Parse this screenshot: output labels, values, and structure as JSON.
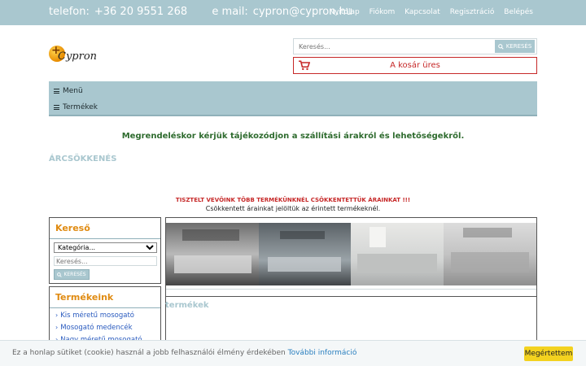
{
  "topbar": {
    "phone_label": "telefon:",
    "phone": "+36 20 9551 268",
    "email_label": "e mail:",
    "email": "cypron@cypron.hu",
    "nav": [
      "Nyitólap",
      "Fiókom",
      "Kapcsolat",
      "Regisztráció",
      "Belépés"
    ]
  },
  "logo": {
    "plus": "+",
    "name": "Cypron"
  },
  "search": {
    "placeholder": "Keresés...",
    "button_label": "KERESÉS"
  },
  "cart": {
    "label": "A kosár üres"
  },
  "menu": {
    "menu_label": "Menü",
    "products_label": "Termékek"
  },
  "notices": {
    "green": "Megrendeléskor kérjük tájékozódjon a szállítási árakról és lehetőségekről.",
    "price_heading": "ÁRCSÖKKENÉS",
    "red": "TISZTELT VEVŐINK TÖBB TERMÉKÜNKNÉL CSÖKKENTETTÜK ÁRAINKAT !!!",
    "black": "Csökkentett árainkat jelöltük az érintett termékeknél."
  },
  "sidebar_search": {
    "title": "Kereső",
    "category_selected": "Kategória...",
    "input_placeholder": "Keresés...",
    "button_label": "KERESÉS"
  },
  "sidebar_products": {
    "title": "Termékeink",
    "items": [
      "Kis méretű mosogató",
      "Mosogató medencék",
      "Nagy méretű mosogató"
    ]
  },
  "main": {
    "section_title": "termékek"
  },
  "cookie": {
    "text": "Ez a honlap sütiket (cookie) használ a jobb felhasználói élmény érdekében",
    "more_label": "További információ",
    "accept_label": "Megértettem"
  },
  "colors": {
    "accent": "#a9c7cf",
    "cart_red": "#c62828",
    "title_orange": "#e08b12",
    "link_blue": "#2a5bbf",
    "cookie_button": "#f3d21f"
  }
}
